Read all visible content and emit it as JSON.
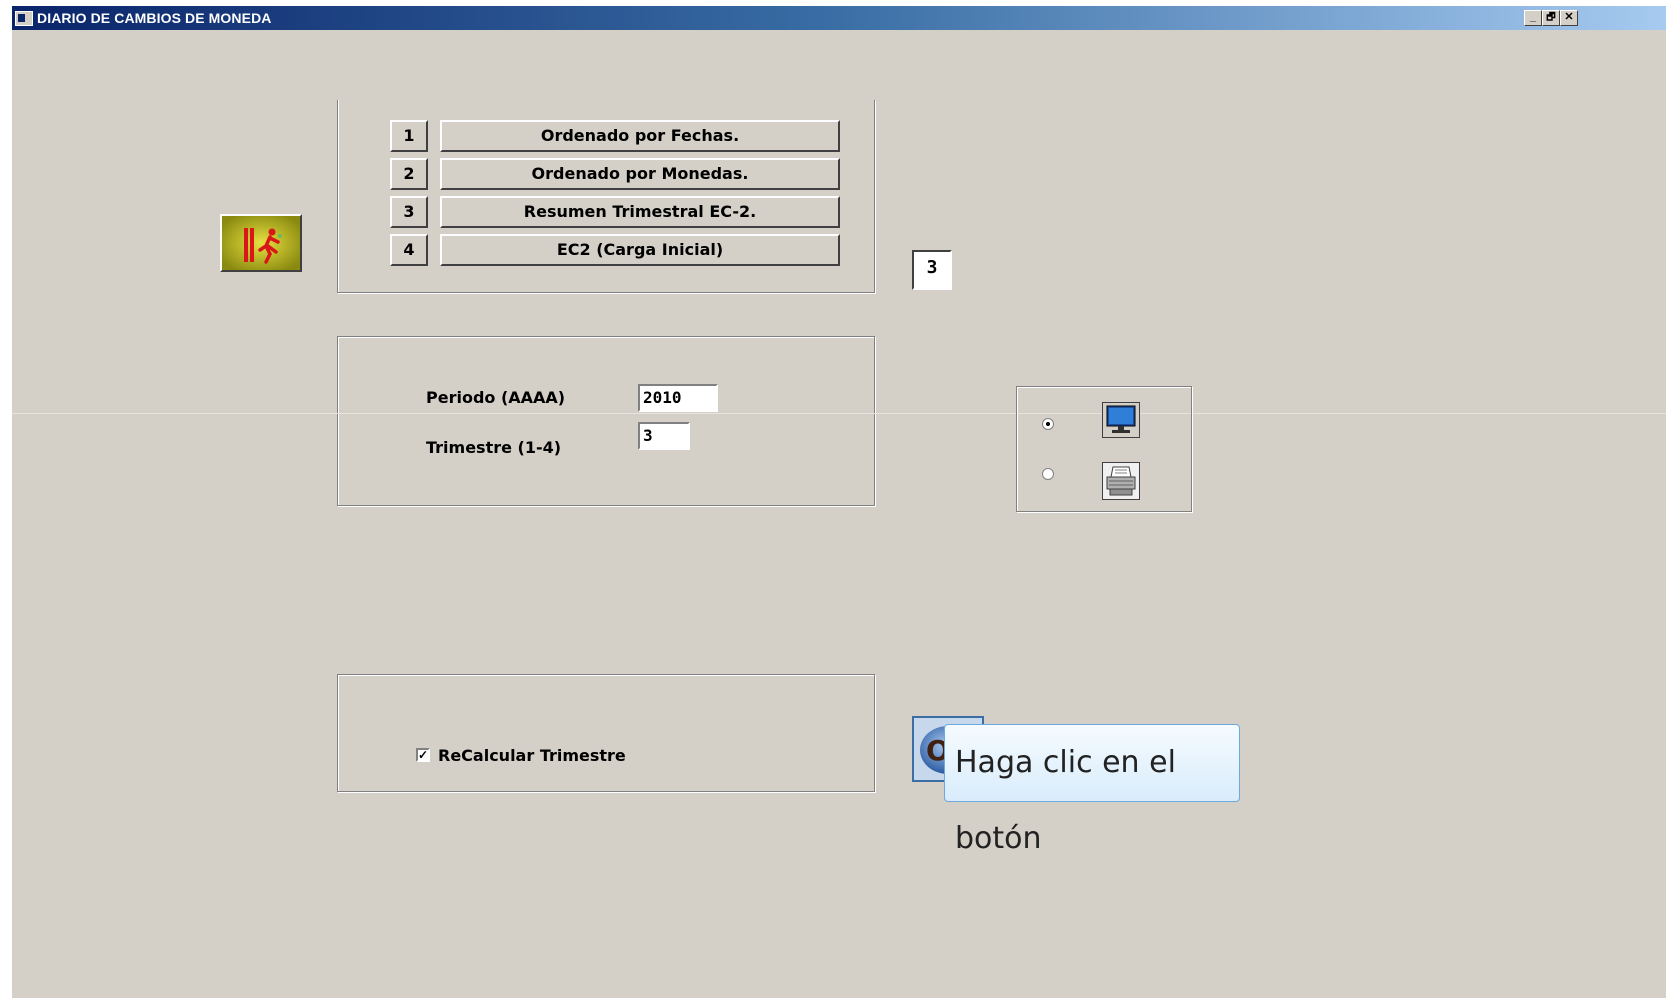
{
  "window": {
    "title": "DIARIO DE CAMBIOS DE MONEDA",
    "minimize_label": "_",
    "restore_label": "🗗",
    "close_label": "✕"
  },
  "report_menu": {
    "items": [
      {
        "number": "1",
        "label": "Ordenado por Fechas."
      },
      {
        "number": "2",
        "label": "Ordenado por Monedas."
      },
      {
        "number": "3",
        "label": "Resumen Trimestral EC-2."
      },
      {
        "number": "4",
        "label": "EC2 (Carga Inicial)"
      }
    ],
    "selected_option": "3"
  },
  "period_form": {
    "periodo_label": "Periodo (AAAA)",
    "periodo_value": "2010",
    "trimestre_label": "Trimestre (1-4)",
    "trimestre_value": "3"
  },
  "output_options": {
    "screen_selected": true,
    "printer_selected": false,
    "screen_icon": "monitor-icon",
    "printer_icon": "printer-icon"
  },
  "recalc": {
    "checked": true,
    "check_mark": "✓",
    "label": "ReCalcular Trimestre"
  },
  "ok_button": {
    "label": "OK",
    "tooltip": "Haga clic en el botón"
  },
  "exit_button": {
    "icon": "exit-door-icon"
  }
}
